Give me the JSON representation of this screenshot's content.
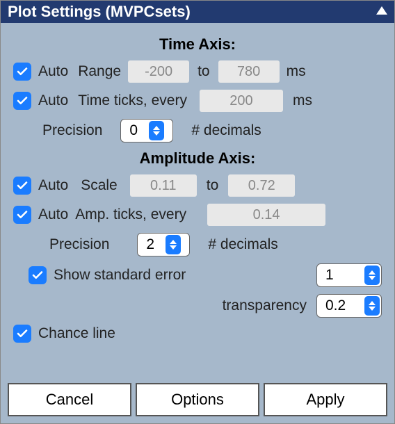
{
  "title": "Plot Settings (MVPCsets)",
  "time_axis": {
    "header": "Time Axis:",
    "auto_label": "Auto",
    "range_label": "Range",
    "range_from": "-200",
    "to_label": "to",
    "range_to": "780",
    "unit": "ms",
    "ticks_label": "Time ticks, every",
    "ticks_value": "200",
    "precision_label": "Precision",
    "precision_value": "0",
    "decimals_label": "# decimals"
  },
  "amp_axis": {
    "header": "Amplitude Axis:",
    "auto_label": "Auto",
    "scale_label": "Scale",
    "scale_from": "0.11",
    "to_label": "to",
    "scale_to": "0.72",
    "ticks_label": "Amp. ticks, every",
    "ticks_value": "0.14",
    "precision_label": "Precision",
    "precision_value": "2",
    "decimals_label": "# decimals"
  },
  "stderr": {
    "label": "Show standard error",
    "value": "1",
    "transparency_label": "transparency",
    "transparency_value": "0.2"
  },
  "chance": {
    "label": "Chance line"
  },
  "buttons": {
    "cancel": "Cancel",
    "options": "Options",
    "apply": "Apply"
  }
}
